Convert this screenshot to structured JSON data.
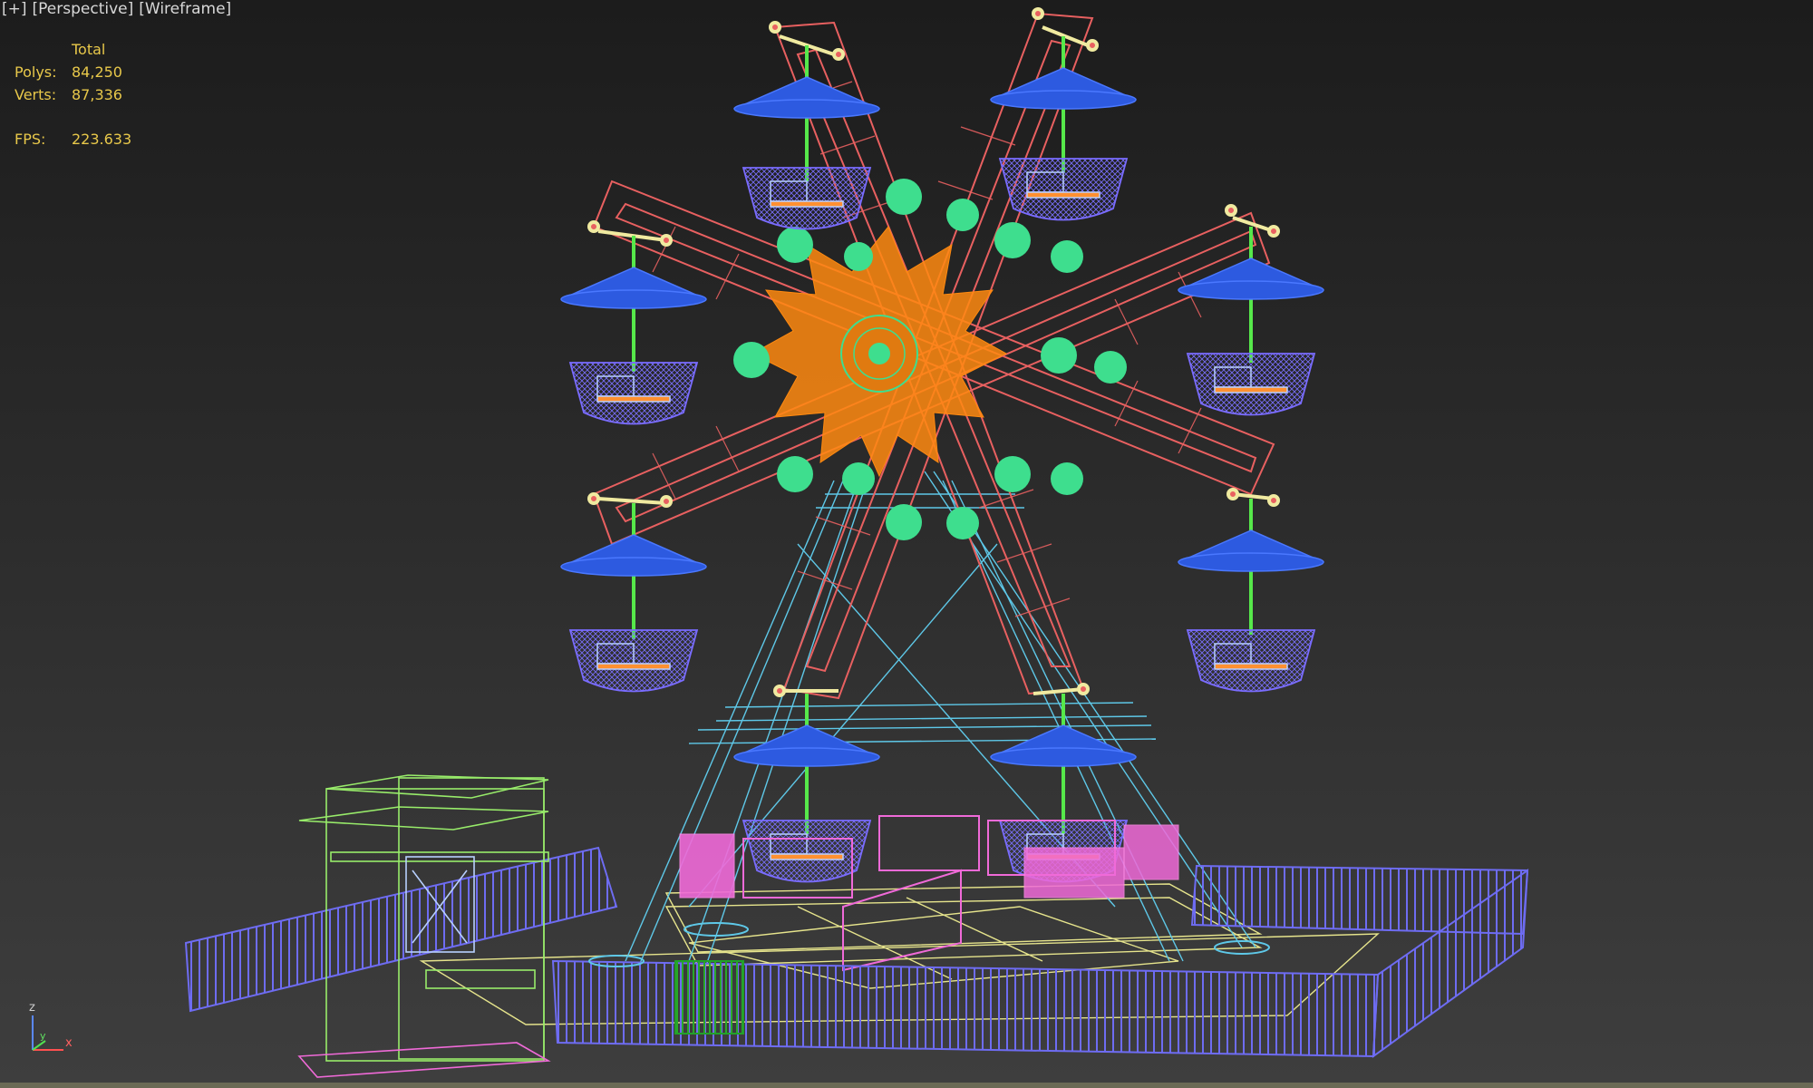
{
  "viewport": {
    "label": {
      "plus": "[+]",
      "view": "[Perspective]",
      "shading": "[Wireframe]"
    },
    "stats": {
      "header": "Total",
      "polys_label": "Polys:",
      "polys_value": "84,250",
      "verts_label": "Verts:",
      "verts_value": "87,336",
      "fps_label": "FPS:",
      "fps_value": "223.633"
    },
    "axis_gizmo": {
      "x": "x",
      "y": "y",
      "z": "z"
    }
  },
  "colors": {
    "frame": "#e86060",
    "hub": "#ff8a10",
    "joint": "#3ede8e",
    "umbrella": "#2d5ae0",
    "cabin": "#6a58ef",
    "support": "#5ec8e8",
    "fence": "#6e6cf2",
    "booth": "#98ec6a",
    "platform": "#e6e48c",
    "pink": "#f06ad8",
    "gate": "#22a02a",
    "hanger": "#56e84a"
  }
}
